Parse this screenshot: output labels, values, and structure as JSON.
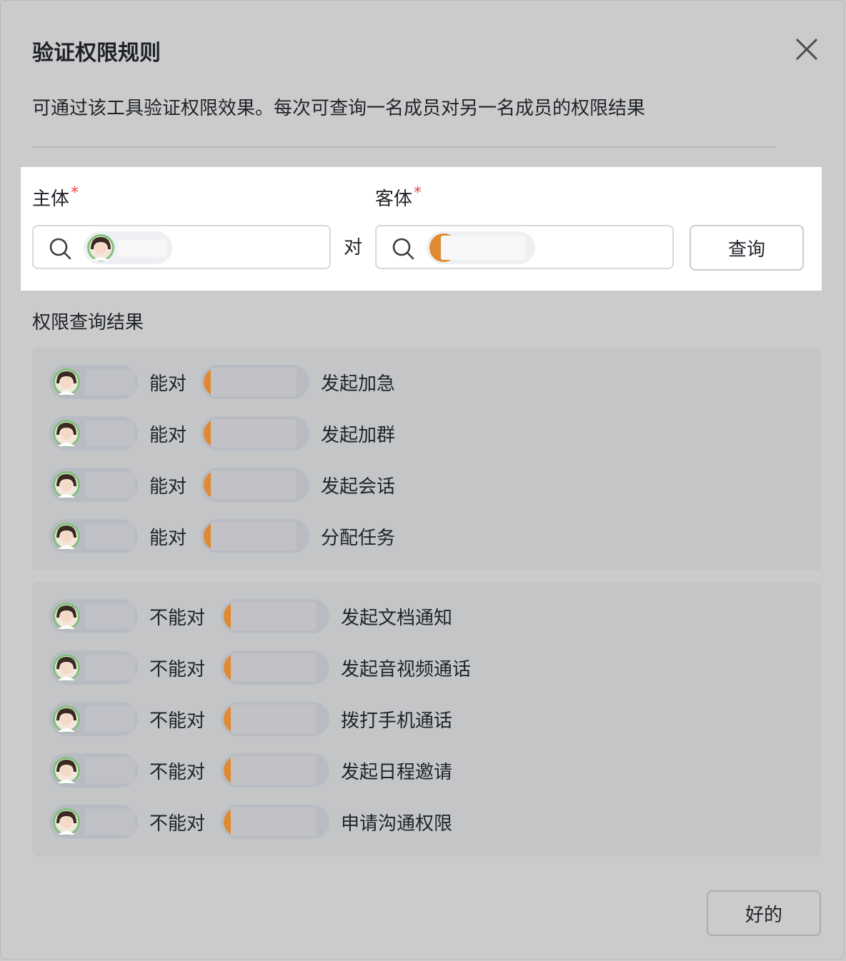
{
  "dialog": {
    "title": "验证权限规则",
    "description": "可通过该工具验证权限效果。每次可查询一名成员对另一名成员的权限结果"
  },
  "form": {
    "subject_label": "主体",
    "object_label": "客体",
    "required_mark": "*",
    "connector": "对",
    "query_button": "查询"
  },
  "results": {
    "title": "权限查询结果",
    "allowed_verb": "能对",
    "denied_verb": "不能对",
    "allowed": [
      {
        "action": "发起加急"
      },
      {
        "action": "发起加群"
      },
      {
        "action": "发起会话"
      },
      {
        "action": "分配任务"
      }
    ],
    "denied": [
      {
        "action": "发起文档通知"
      },
      {
        "action": "发起音视频通话"
      },
      {
        "action": "拨打手机通话"
      },
      {
        "action": "发起日程邀请"
      },
      {
        "action": "申请沟通权限"
      }
    ]
  },
  "footer": {
    "ok_button": "好的"
  },
  "colors": {
    "required": "#e5484d",
    "object_avatar": "#e08a34",
    "subject_avatar_ring": "#7ec27a"
  },
  "icons": {
    "close": "close-icon",
    "search": "search-icon",
    "avatar": "avatar-photo"
  }
}
